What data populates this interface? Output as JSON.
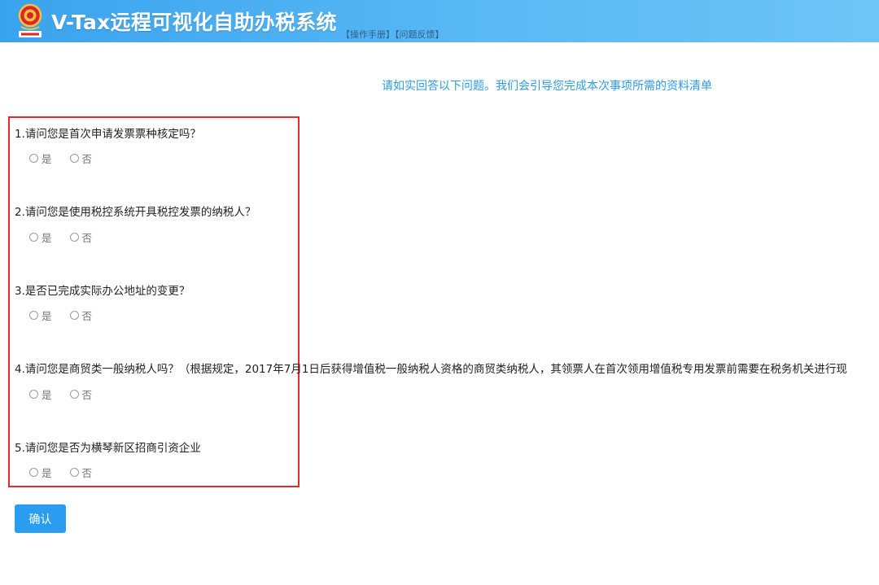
{
  "header": {
    "title": "V-Tax远程可视化自助办税系统",
    "links": [
      "【操作手册】",
      "【问题反馈】"
    ],
    "emblem_text": "中国税务"
  },
  "intro": "请如实回答以下问题。我们会引导您完成本次事项所需的资料清单",
  "questions": [
    {
      "text": "1.请问您是首次申请发票票种核定吗？",
      "options": [
        "是",
        "否"
      ]
    },
    {
      "text": "2.请问您是使用税控系统开具税控发票的纳税人？",
      "options": [
        "是",
        "否"
      ]
    },
    {
      "text": "3.是否已完成实际办公地址的变更？",
      "options": [
        "是",
        "否"
      ]
    },
    {
      "text": "4.请问您是商贸类一般纳税人吗？（根据规定，2017年7月1日后获得增值税一般纳税人资格的商贸类纳税人，其领票人在首次领用增值税专用发票前需要在税务机关进行现",
      "options": [
        "是",
        "否"
      ]
    },
    {
      "text": "5.请问您是否为横琴新区招商引资企业",
      "options": [
        "是",
        "否"
      ]
    }
  ],
  "confirm_label": "确认",
  "colors": {
    "header": "#3aa3ee",
    "accent": "#2a9df0",
    "highlight": "#e32b2b",
    "intro": "#2d9be6"
  }
}
